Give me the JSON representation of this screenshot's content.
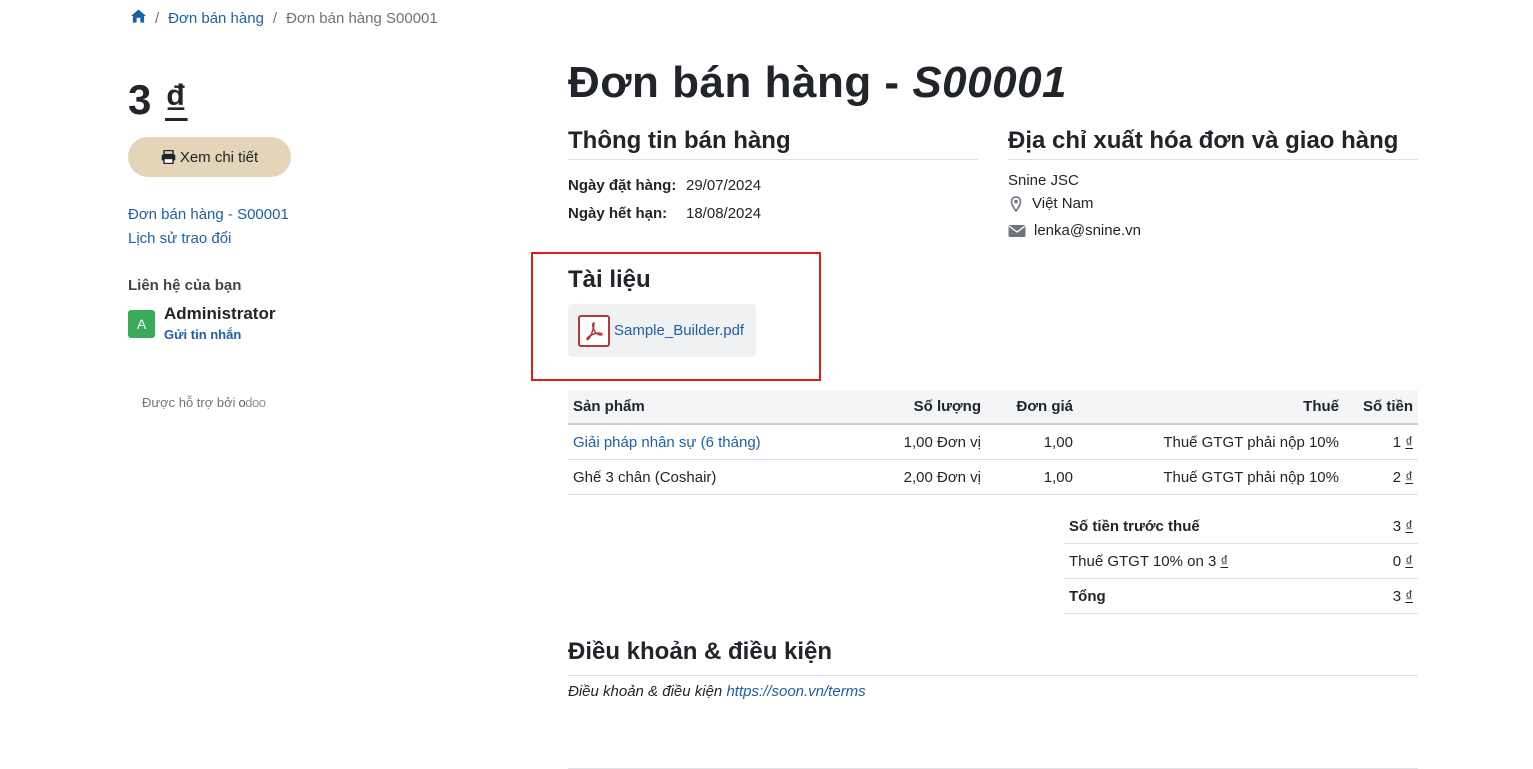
{
  "breadcrumb": {
    "home_icon": "home-icon",
    "level1": "Đơn bán hàng",
    "current": "Đơn bán hàng S00001"
  },
  "sidebar": {
    "amount_value": "3",
    "amount_currency": "₫",
    "view_button_label": "Xem chi tiết",
    "links": [
      "Đơn bán hàng - S00001",
      "Lịch sử trao đổi"
    ],
    "contact_title": "Liên hệ của bạn",
    "contact_avatar_letter": "A",
    "contact_name": "Administrator",
    "contact_message": "Gửi tin nhắn",
    "powered_by": "Được hỗ trợ bởi",
    "powered_logo": "odoo"
  },
  "main": {
    "title_prefix": "Đơn bán hàng - ",
    "title_ref": "S00001",
    "sales_info": {
      "title": "Thông tin bán hàng",
      "order_date_label": "Ngày đặt hàng:",
      "order_date": "29/07/2024",
      "expiry_label": "Ngày hết hạn:",
      "expiry_date": "18/08/2024"
    },
    "address": {
      "title": "Địa chỉ xuất hóa đơn và giao hàng",
      "company": "Snine JSC",
      "country": "Việt Nam",
      "email": "lenka@snine.vn"
    },
    "documents": {
      "title": "Tài liệu",
      "files": [
        "Sample_Builder.pdf"
      ]
    },
    "lines_table": {
      "headers": [
        "Sản phẩm",
        "Số lượng",
        "Đơn giá",
        "Thuế",
        "Số tiền"
      ],
      "rows": [
        {
          "product": "Giải pháp nhân sự (6 tháng)",
          "qty": "1,00 Đơn vị",
          "price": "1,00",
          "tax": "Thuế GTGT phải nộp 10%",
          "amount": "1",
          "cur": "₫"
        },
        {
          "product": "Ghế 3 chân (Coshair)",
          "qty": "2,00 Đơn vị",
          "price": "1,00",
          "tax": "Thuế GTGT phải nộp 10%",
          "amount": "2",
          "cur": "₫"
        }
      ]
    },
    "totals": {
      "untaxed_label": "Số tiền trước thuế",
      "untaxed_value": "3",
      "tax_label_prefix": "Thuế GTGT 10% on 3",
      "tax_value": "0",
      "total_label": "Tổng",
      "total_value": "3",
      "cur": "₫"
    },
    "terms": {
      "title": "Điều khoản & điều kiện",
      "text": "Điều khoản & điều kiện",
      "link": "https://soon.vn/terms"
    }
  },
  "colors": {
    "link": "#1f5fa8",
    "button_bg": "#e4d5b9",
    "avatar_bg": "#3aaa5b",
    "highlight_border": "#e01b1b"
  }
}
